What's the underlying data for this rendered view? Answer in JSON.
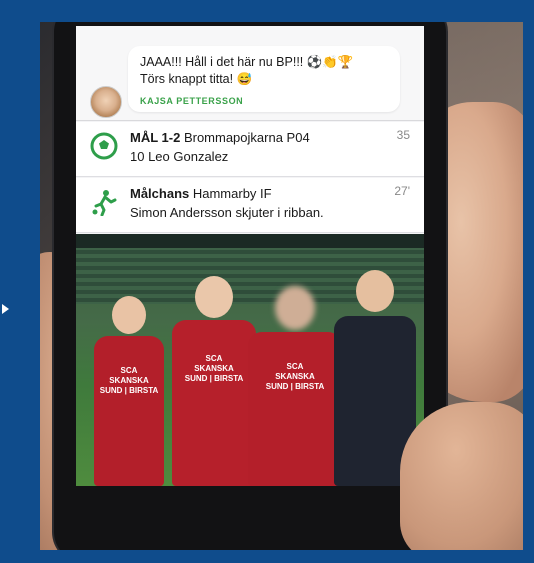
{
  "chat": {
    "partial_top": "' ' ' '",
    "message_line1": "JAAA!!! Håll i det här nu BP!!! ⚽👏🏆",
    "message_line2": "Törs knappt titta! 😅",
    "author": "KAJSA PETTERSSON"
  },
  "events": [
    {
      "icon": "soccer-ball-icon",
      "title_bold": "MÅL 1-2",
      "title_rest": " Brommapojkarna P04",
      "detail": "10 Leo Gonzalez",
      "time": "35"
    },
    {
      "icon": "kicking-player-icon",
      "title_bold": "Målchans",
      "title_rest": " Hammarby IF",
      "detail": "Simon Andersson skjuter i ribban.",
      "time": "27'"
    }
  ],
  "photo": {
    "sponsor_line1": "SCA",
    "sponsor_line2": "SKANSKA",
    "sponsor_line3": "SUND | BIRSTA"
  },
  "colors": {
    "frame_blue": "#0f4c8c",
    "author_green": "#3aa24a",
    "goal_icon_green": "#2e9e4a",
    "jersey_red": "#b31f2a"
  }
}
